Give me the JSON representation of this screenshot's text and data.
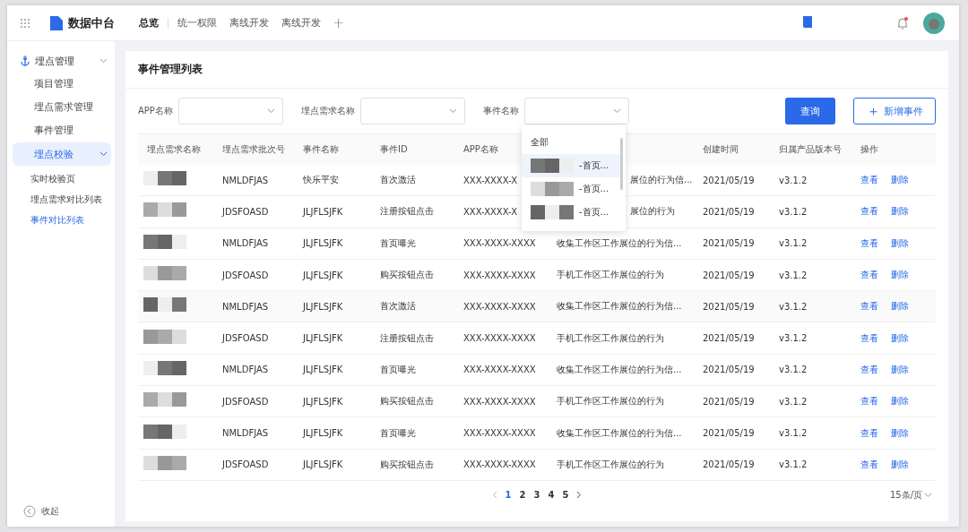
{
  "header": {
    "app_name": "数据中台",
    "tabs": [
      {
        "label": "总览",
        "selected": true
      },
      {
        "label": "统一权限",
        "selected": false
      },
      {
        "label": "离线开发",
        "selected": false
      },
      {
        "label": "离线开发",
        "selected": false
      }
    ],
    "add": "+"
  },
  "sidebar": {
    "group": {
      "label": "埋点管理",
      "expanded": true
    },
    "items": [
      {
        "label": "项目管理",
        "selected": false
      },
      {
        "label": "埋点需求管理",
        "selected": false
      },
      {
        "label": "事件管理",
        "selected": false
      },
      {
        "label": "埋点校验",
        "selected": true,
        "expanded": true,
        "children": [
          {
            "label": "实时校验页",
            "selected": false
          },
          {
            "label": "埋点需求对比列表",
            "selected": false
          },
          {
            "label": "事件对比列表",
            "selected": true
          }
        ]
      }
    ],
    "collapse": "收起"
  },
  "card": {
    "title": "事件管理列表"
  },
  "filters": [
    {
      "label": "APP名称"
    },
    {
      "label": "埋点需求名称"
    },
    {
      "label": "事件名称"
    }
  ],
  "buttons": {
    "query": "查询",
    "add_icon": "＋",
    "add": "新增事件"
  },
  "dropdown": {
    "items": [
      {
        "label": "全部",
        "selected": false,
        "redacted": false
      },
      {
        "label": "-首页...",
        "selected": true,
        "redacted": true
      },
      {
        "label": "-首页...",
        "selected": false,
        "redacted": true
      },
      {
        "label": "-首页...",
        "selected": false,
        "redacted": true
      }
    ]
  },
  "table": {
    "columns": [
      "埋点需求名称",
      "埋点需求批次号",
      "事件名称",
      "事件ID",
      "APP名称",
      "",
      "创建时间",
      "归属产品版本号",
      "操作"
    ],
    "rows": [
      {
        "batch": "NMLDFJAS",
        "event": "快乐平安",
        "event_id": "首次激活",
        "app": "XXX-XXXX-X",
        "desc": "展位的行为信...",
        "partial": true,
        "date": "2021/05/19",
        "version": "v3.1.2",
        "view": "查看",
        "delete": "删除"
      },
      {
        "batch": "JDSFOASD",
        "event": "JLJFLSJFK",
        "event_id": "注册按钮点击",
        "app": "XXX-XXXX-X",
        "desc": "展位的行为",
        "partial": true,
        "date": "2021/05/19",
        "version": "v3.1.2",
        "view": "查看",
        "delete": "删除"
      },
      {
        "batch": "NMLDFJAS",
        "event": "JLJFLSJFK",
        "event_id": "首页曝光",
        "app": "XXX-XXXX-XXXX",
        "desc": "收集工作区工作展位的行为信...",
        "partial": false,
        "date": "2021/05/19",
        "version": "v3.1.2",
        "view": "查看",
        "delete": "删除"
      },
      {
        "batch": "JDSFOASD",
        "event": "JLJFLSJFK",
        "event_id": "购买按钮点击",
        "app": "XXX-XXXX-XXXX",
        "desc": "手机工作区工作展位的行为",
        "partial": false,
        "date": "2021/05/19",
        "version": "v3.1.2",
        "view": "查看",
        "delete": "删除"
      },
      {
        "batch": "NMLDFJAS",
        "event": "JLJFLSJFK",
        "event_id": "首次激活",
        "app": "XXX-XXXX-XXXX",
        "desc": "收集工作区工作展位的行为信...",
        "partial": false,
        "date": "2021/05/19",
        "version": "v3.1.2",
        "view": "查看",
        "delete": "删除"
      },
      {
        "batch": "JDSFOASD",
        "event": "JLJFLSJFK",
        "event_id": "注册按钮点击",
        "app": "XXX-XXXX-XXXX",
        "desc": "手机工作区工作展位的行为",
        "partial": false,
        "date": "2021/05/19",
        "version": "v3.1.2",
        "view": "查看",
        "delete": "删除"
      },
      {
        "batch": "NMLDFJAS",
        "event": "JLJFLSJFK",
        "event_id": "首页曝光",
        "app": "XXX-XXXX-XXXX",
        "desc": "收集工作区工作展位的行为信...",
        "partial": false,
        "date": "2021/05/19",
        "version": "v3.1.2",
        "view": "查看",
        "delete": "删除"
      },
      {
        "batch": "JDSFOASD",
        "event": "JLJFLSJFK",
        "event_id": "购买按钮点击",
        "app": "XXX-XXXX-XXXX",
        "desc": "手机工作区工作展位的行为",
        "partial": false,
        "date": "2021/05/19",
        "version": "v3.1.2",
        "view": "查看",
        "delete": "删除"
      },
      {
        "batch": "NMLDFJAS",
        "event": "JLJFLSJFK",
        "event_id": "首页曝光",
        "app": "XXX-XXXX-XXXX",
        "desc": "收集工作区工作展位的行为信...",
        "partial": false,
        "date": "2021/05/19",
        "version": "v3.1.2",
        "view": "查看",
        "delete": "删除"
      },
      {
        "batch": "JDSFOASD",
        "event": "JLJFLSJFK",
        "event_id": "购买按钮点击",
        "app": "XXX-XXXX-XXXX",
        "desc": "手机工作区工作展位的行为",
        "partial": false,
        "date": "2021/05/19",
        "version": "v3.1.2",
        "view": "查看",
        "delete": "删除"
      }
    ]
  },
  "pagination": {
    "pages": [
      {
        "label": "1",
        "selected": true
      },
      {
        "label": "2",
        "selected": false
      },
      {
        "label": "3",
        "selected": false
      },
      {
        "label": "4",
        "selected": false
      },
      {
        "label": "5",
        "selected": false
      }
    ],
    "page_size": "15条/页"
  }
}
